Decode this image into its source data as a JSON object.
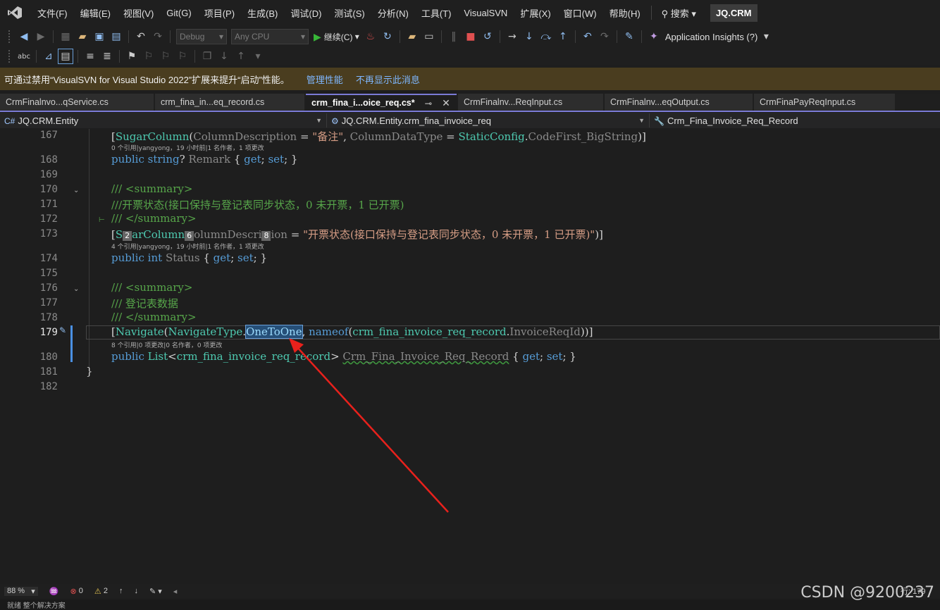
{
  "menubar": {
    "items": [
      "文件(F)",
      "编辑(E)",
      "视图(V)",
      "Git(G)",
      "项目(P)",
      "生成(B)",
      "调试(D)",
      "测试(S)",
      "分析(N)",
      "工具(T)",
      "VisualSVN",
      "扩展(X)",
      "窗口(W)",
      "帮助(H)"
    ],
    "search_label": "搜索",
    "project_name": "JQ.CRM"
  },
  "toolbar": {
    "config": "Debug",
    "platform": "Any CPU",
    "continue_label": "继续(C)",
    "insights_label": "Application Insights (?)"
  },
  "infobar": {
    "message": "可通过禁用“VisualSVN for Visual Studio 2022”扩展来提升“启动”性能。",
    "manage_link": "管理性能",
    "dismiss_link": "不再显示此消息"
  },
  "tabs": [
    {
      "label": "CrmFinalnvo...qService.cs"
    },
    {
      "label": "crm_fina_in...eq_record.cs"
    },
    {
      "label": "crm_fina_i...oice_req.cs*",
      "active": true
    },
    {
      "label": "CrmFinalnv...ReqInput.cs"
    },
    {
      "label": "CrmFinalnv...eqOutput.cs"
    },
    {
      "label": "CrmFinaPayReqInput.cs"
    }
  ],
  "navbar": {
    "project": "JQ.CRM.Entity",
    "type": "JQ.CRM.Entity.crm_fina_invoice_req",
    "member": "Crm_Fina_Invoice_Req_Record"
  },
  "editor": {
    "line_numbers": [
      "167",
      "168",
      "169",
      "170",
      "171",
      "172",
      "173",
      "174",
      "175",
      "176",
      "177",
      "178",
      "179",
      "180",
      "181",
      "182"
    ],
    "current_line": "179",
    "codelens": {
      "l167": "0 个引用|yangyong，19 小时前|1 名作者，1 项更改",
      "l173": "4 个引用|yangyong，19 小时前|1 名作者，1 项更改",
      "l179": "8 个引用|0 项更改|0 名作者，0 项更改"
    },
    "badges": [
      "2",
      "6",
      "8"
    ]
  },
  "statusbar": {
    "zoom": "88 %",
    "errors": "0",
    "warnings": "2",
    "position": "行: 179"
  },
  "bottombar": {
    "text": "就绪  整个解决方案"
  },
  "watermark": "CSDN @9200237",
  "colors": {
    "accent": "#7a7ad6",
    "infobar_bg": "#4a3d1f",
    "arrow": "#e8211c"
  }
}
